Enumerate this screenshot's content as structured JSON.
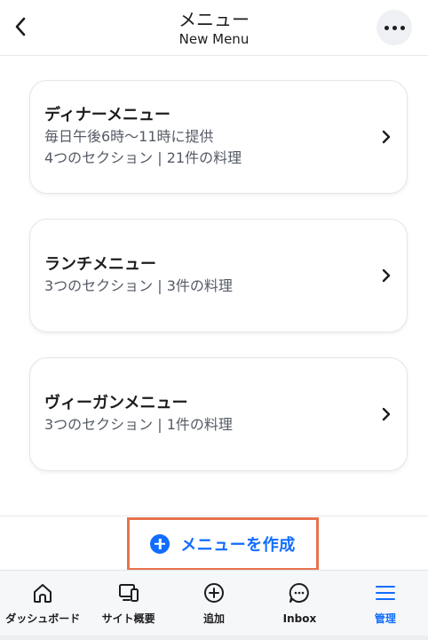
{
  "header": {
    "title": "メニュー",
    "subtitle": "New Menu"
  },
  "menus": [
    {
      "title": "ディナーメニュー",
      "schedule": "毎日午後6時～11時に提供",
      "summary": "4つのセクション | 21件の料理"
    },
    {
      "title": "ランチメニュー",
      "summary": "3つのセクション | 3件の料理"
    },
    {
      "title": "ヴィーガンメニュー",
      "summary": "3つのセクション | 1件の料理"
    }
  ],
  "create_button": {
    "label": "メニューを作成",
    "icon": "plus-circle-icon"
  },
  "bottom_nav": [
    {
      "label": "ダッシュボード",
      "icon": "home-icon",
      "active": false
    },
    {
      "label": "サイト概要",
      "icon": "devices-icon",
      "active": false
    },
    {
      "label": "追加",
      "icon": "add-circle-icon",
      "active": false
    },
    {
      "label": "Inbox",
      "icon": "chat-bubble-icon",
      "active": false
    },
    {
      "label": "管理",
      "icon": "hamburger-menu-icon",
      "active": true
    }
  ],
  "colors": {
    "accent": "#116dff",
    "highlight_border": "#e8734f",
    "text_primary": "#1d1d1f",
    "text_secondary": "#555b66"
  }
}
